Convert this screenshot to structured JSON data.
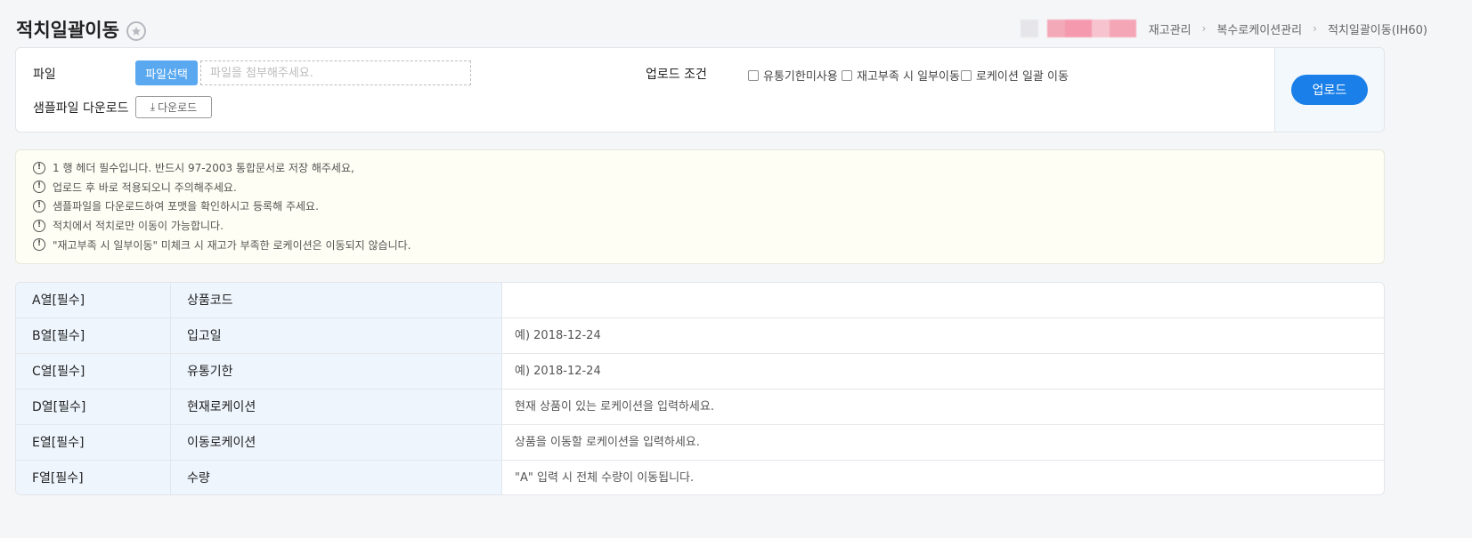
{
  "header": {
    "title": "적치일괄이동",
    "breadcrumb": [
      "재고관리",
      "복수로케이션관리",
      "적치일괄이동(IH60)"
    ]
  },
  "upload": {
    "file_label": "파일",
    "file_button": "파일선택",
    "file_placeholder": "파일을 첨부해주세요.",
    "sample_label": "샘플파일 다운로드",
    "download_button": "다운로드",
    "condition_label": "업로드 조건",
    "conditions": [
      "유통기한미사용",
      "재고부족 시 일부이동",
      "로케이션 일괄 이동"
    ],
    "upload_button": "업로드"
  },
  "notices": [
    "1 행 헤더 필수입니다. 반드시 97-2003 통합문서로 저장 해주세요,",
    "업로드 후 바로 적용되오니 주의해주세요.",
    "샘플파일을 다운로드하여 포맷을 확인하시고 등록해 주세요.",
    "적치에서 적치로만 이동이 가능합니다.",
    "\"재고부족 시 일부이동\" 미체크 시 재고가 부족한 로케이션은 이동되지 않습니다."
  ],
  "columns": [
    {
      "col": "A열[필수]",
      "name": "상품코드",
      "desc": ""
    },
    {
      "col": "B열[필수]",
      "name": "입고일",
      "desc": "예) 2018-12-24"
    },
    {
      "col": "C열[필수]",
      "name": "유통기한",
      "desc": "예) 2018-12-24"
    },
    {
      "col": "D열[필수]",
      "name": "현재로케이션",
      "desc": "현재 상품이 있는 로케이션을 입력하세요."
    },
    {
      "col": "E열[필수]",
      "name": "이동로케이션",
      "desc": "상품을 이동할 로케이션을 입력하세요."
    },
    {
      "col": "F열[필수]",
      "name": "수량",
      "desc": "\"A\" 입력 시 전체 수량이 이동됩니다."
    }
  ],
  "colors": {
    "accent": "#1a7fe8",
    "file_button": "#5aa9f0",
    "notice_bg": "#fefef4",
    "label_bg": "#eef5fd"
  }
}
